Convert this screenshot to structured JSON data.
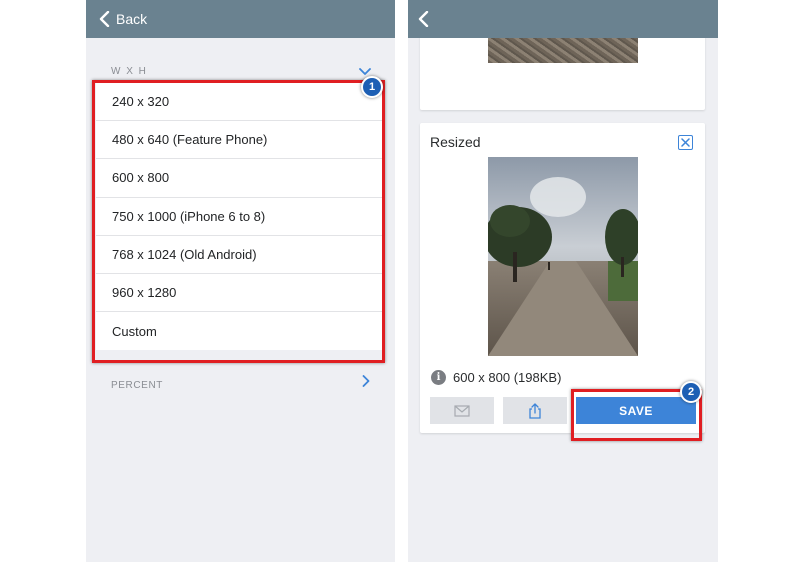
{
  "left_screen": {
    "nav": {
      "back_label": "Back",
      "back_icon": "chevron-left-icon"
    },
    "dimension_section": {
      "header": "W X H",
      "icon": "chevron-down-icon"
    },
    "size_options": [
      "240 x 320",
      "480 x 640 (Feature Phone)",
      "600 x 800",
      "750 x 1000 (iPhone 6 to 8)",
      "768 x 1024 (Old Android)",
      "960 x 1280",
      "Custom"
    ],
    "percent_section": {
      "header": "PERCENT",
      "icon": "chevron-right-icon"
    }
  },
  "right_screen": {
    "nav": {
      "back_icon": "chevron-left-icon"
    },
    "resized_card": {
      "title": "Resized",
      "close_icon": "close-box-icon",
      "info_icon": "info-icon",
      "info_text": "600 x 800 (198KB)",
      "actions": {
        "mail_icon": "mail-icon",
        "share_icon": "share-icon",
        "save_label": "SAVE"
      }
    }
  },
  "annotations": {
    "step1": "1",
    "step2": "2"
  },
  "colors": {
    "nav_bar": "#6a8290",
    "accent_blue": "#3d84d8",
    "highlight_red": "#e01e22",
    "badge_blue": "#1d5fb4"
  }
}
